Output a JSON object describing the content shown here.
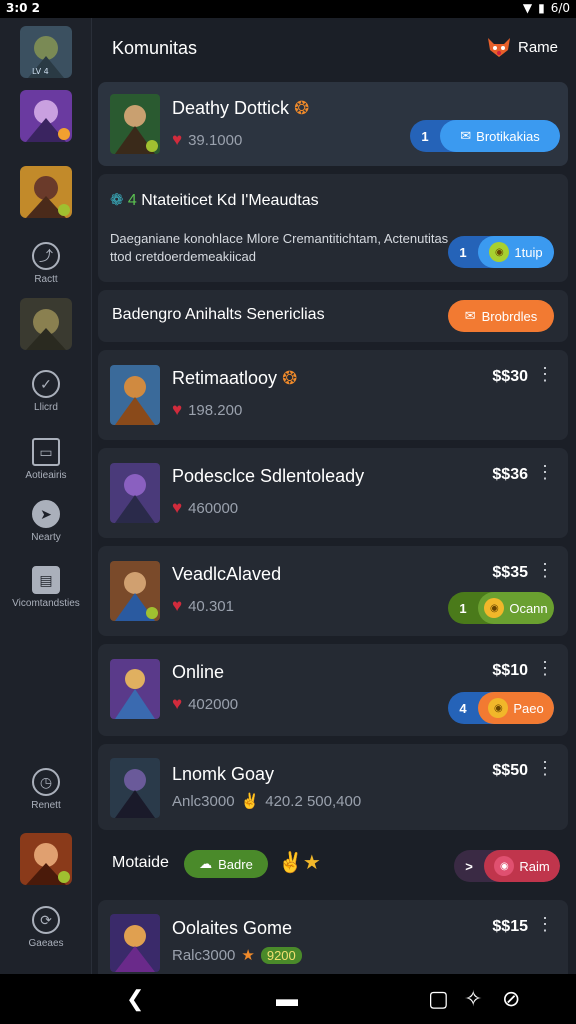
{
  "status": {
    "time": "3:0 2",
    "battery": "6/0"
  },
  "sidebar": {
    "items": [
      {
        "label": "Ractt"
      },
      {
        "label": "Llicrd"
      },
      {
        "label": "Aotieairis"
      },
      {
        "label": "Nearty"
      },
      {
        "label": "Vicomtandsties"
      },
      {
        "label": "Renett"
      },
      {
        "label": "Gaeaes"
      }
    ]
  },
  "header": {
    "title": "Komunitas",
    "right_label": "Rame"
  },
  "featured": {
    "title": "Deathy Dottick",
    "likes": "39.1000",
    "pill_num": "1",
    "pill_label": "Brotikakias"
  },
  "community_card": {
    "title": "Ntateiticet Kd I'Meaudtas",
    "body": "Daeganiane konohlace Mlore Cremantitichtam, Actenutitas ttod cretdoerdemeakiicad",
    "pill_num": "1",
    "pill_label": "1tuip"
  },
  "section": {
    "title": "Badengro Anihalts Senericlias",
    "button_label": "Brobrdles"
  },
  "games": [
    {
      "title": "Retimaatlooy",
      "likes": "198.200",
      "price": "$$30"
    },
    {
      "title": "Podesclce Sdlentoleady",
      "likes": "460000",
      "price": "$$36"
    },
    {
      "title": "VeadlcAlaved",
      "likes": "40.301",
      "price": "$$35",
      "pill_num": "1",
      "pill_label": "Ocann"
    },
    {
      "title": "Online",
      "likes": "402000",
      "price": "$$10",
      "pill_num": "4",
      "pill_label": "Paeo"
    },
    {
      "title": "Lnomk Goay",
      "likes": "Anlc3000",
      "likes_extra": "420.2 500,400",
      "price": "$$50"
    },
    {
      "title": "Oolaites Gome",
      "likes": "Ralc3000",
      "likes_extra": "9200",
      "price": "$$15"
    }
  ],
  "mutable": {
    "label": "Motaide",
    "badge_label": "Badre",
    "pill_num": ">",
    "pill_label": "Raim"
  },
  "colors": {
    "accent_blue": "#3b82f6",
    "accent_orange": "#f27a32",
    "accent_green": "#5a8f2a",
    "accent_red": "#c0354c"
  }
}
